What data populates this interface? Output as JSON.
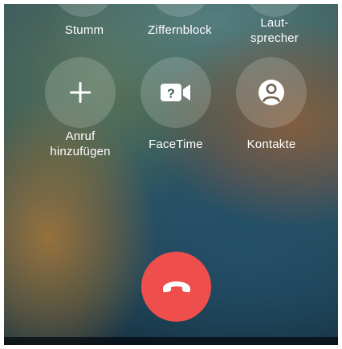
{
  "top_row": {
    "mute_label": "Stumm",
    "keypad_label": "Ziffernblock",
    "speaker_label": "Laut-\nsprecher"
  },
  "middle_row": {
    "add_call_label": "Anruf\nhinzufügen",
    "facetime_label": "FaceTime",
    "contacts_label": "Kontakte"
  },
  "icons": {
    "add_call": "plus-icon",
    "facetime": "facetime-icon",
    "contacts": "person-circle-icon",
    "end_call": "phone-down-icon"
  },
  "colors": {
    "end_call": "#ef4f4c",
    "button_fill": "rgba(255,255,255,0.17)",
    "text": "#ffffff"
  }
}
